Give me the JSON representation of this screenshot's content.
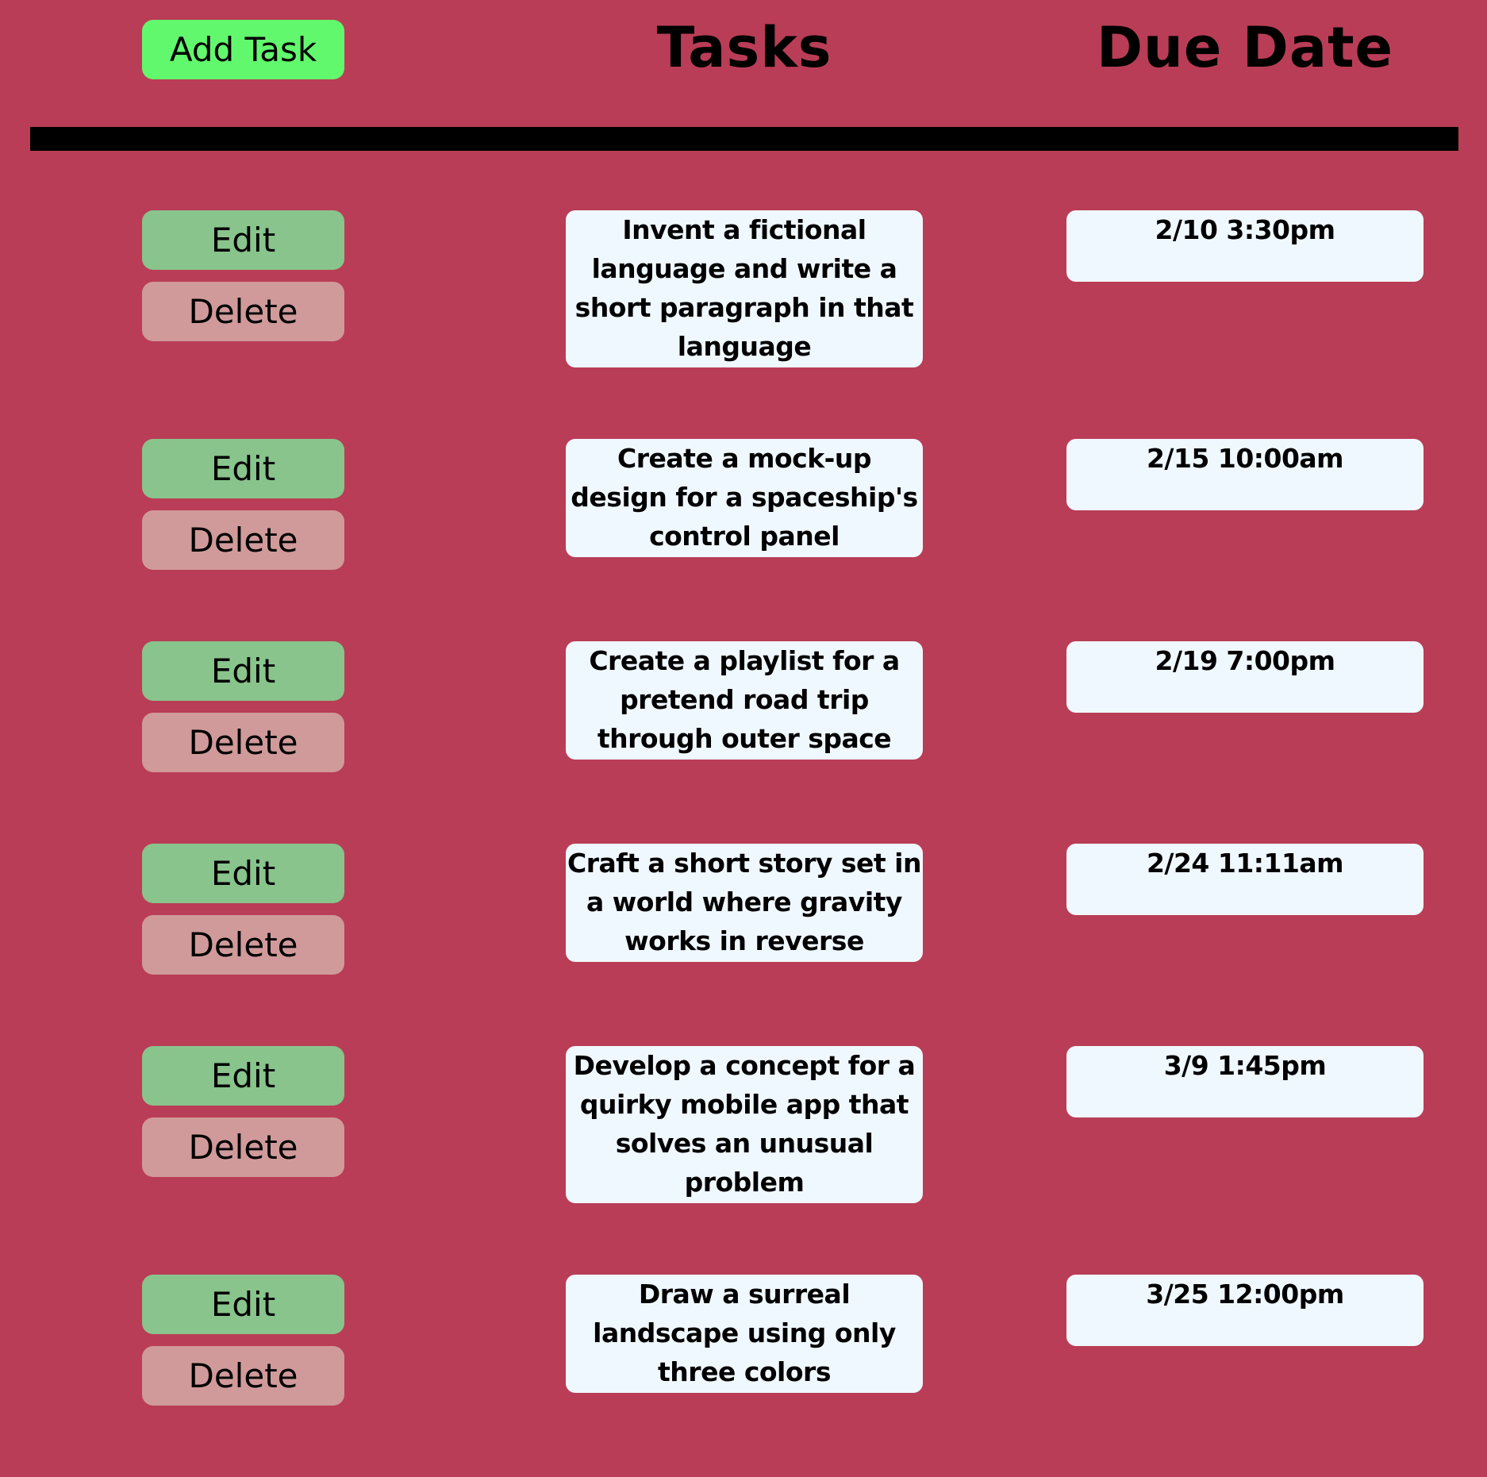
{
  "header": {
    "add_task_label": "Add Task",
    "tasks_heading": "Tasks",
    "due_date_heading": "Due Date"
  },
  "colors": {
    "background": "#b93d56",
    "add_button": "#62f86e",
    "edit_button": "#88c48c",
    "delete_button": "#d09a9a",
    "card_background": "#f0f8ff",
    "divider": "#000000"
  },
  "tasks": [
    {
      "edit_label": "Edit",
      "delete_label": "Delete",
      "description": "Invent a fictional language and write a short paragraph in that language",
      "due": "2/10 3:30pm"
    },
    {
      "edit_label": "Edit",
      "delete_label": "Delete",
      "description": "Create a mock-up design for a spaceship's control panel",
      "due": "2/15 10:00am"
    },
    {
      "edit_label": "Edit",
      "delete_label": "Delete",
      "description": "Create a playlist for a pretend road trip through outer space",
      "due": "2/19 7:00pm"
    },
    {
      "edit_label": "Edit",
      "delete_label": "Delete",
      "description": "Craft a short story set in a world where gravity works in reverse",
      "due": "2/24 11:11am"
    },
    {
      "edit_label": "Edit",
      "delete_label": "Delete",
      "description": "Develop a concept for a quirky mobile app that solves an unusual problem",
      "due": "3/9 1:45pm"
    },
    {
      "edit_label": "Edit",
      "delete_label": "Delete",
      "description": "Draw a surreal landscape using only three colors",
      "due": "3/25 12:00pm"
    }
  ]
}
